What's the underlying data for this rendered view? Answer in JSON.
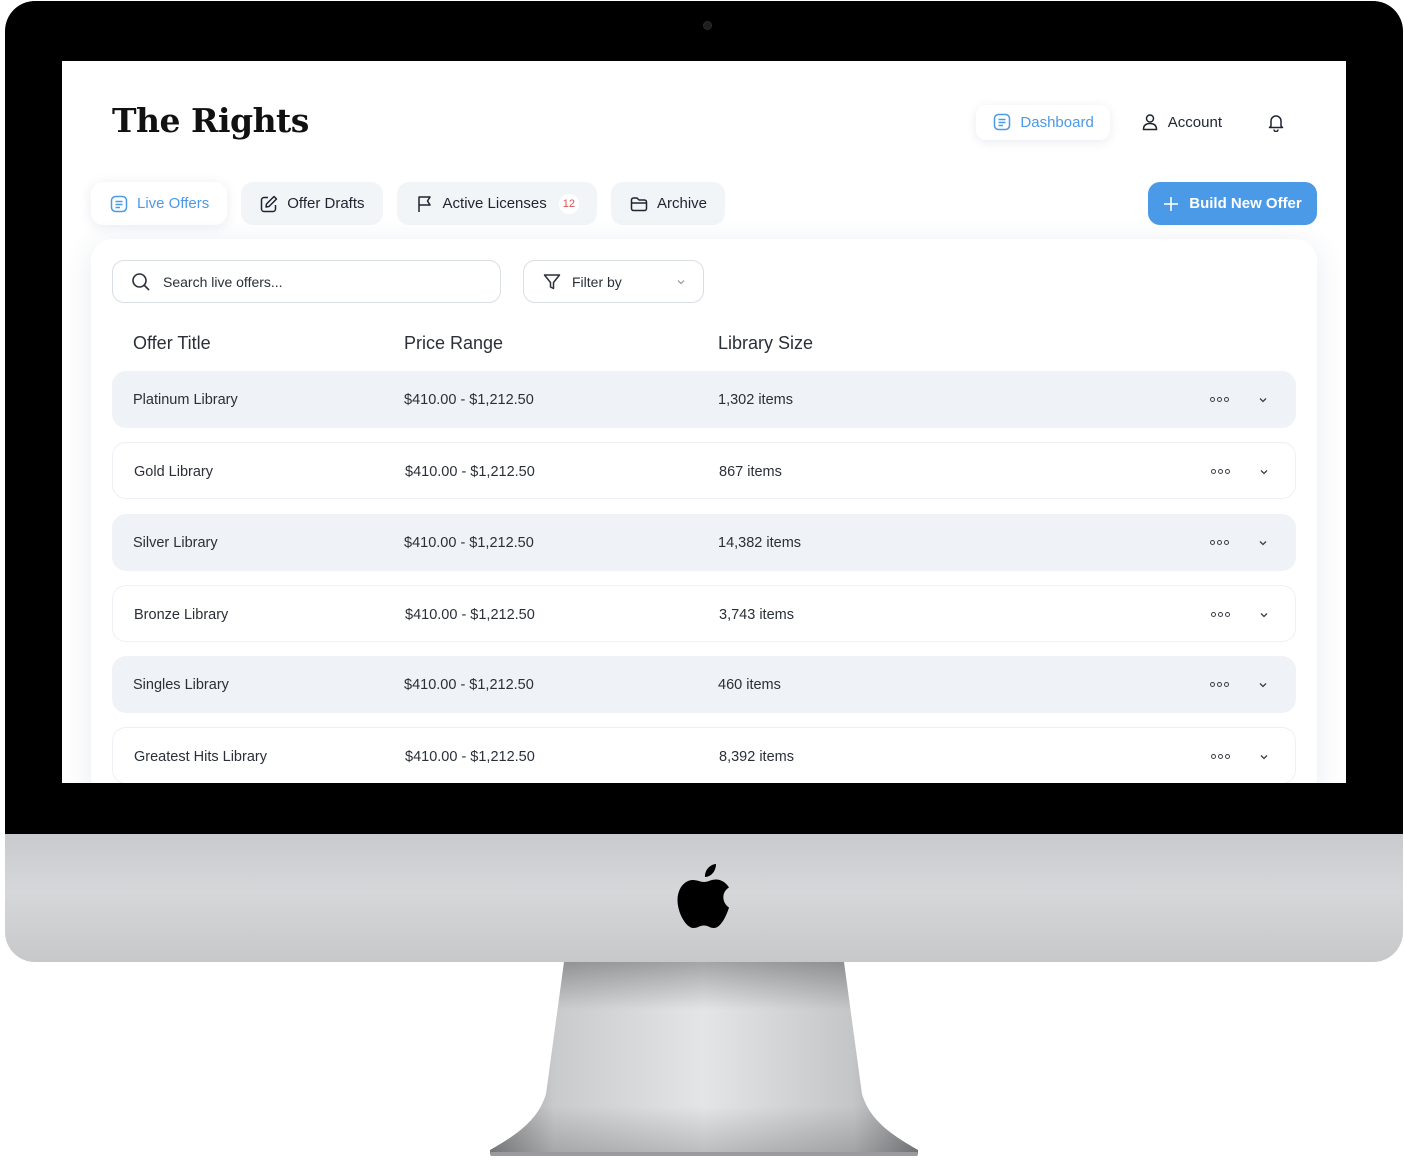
{
  "app": {
    "logo": "The Rights"
  },
  "topnav": {
    "dashboard_label": "Dashboard",
    "account_label": "Account"
  },
  "tabs": [
    {
      "label": "Live Offers",
      "icon": "document-icon",
      "active": true
    },
    {
      "label": "Offer Drafts",
      "icon": "edit-icon",
      "active": false
    },
    {
      "label": "Active Licenses",
      "icon": "flag-icon",
      "active": false,
      "badge": "12"
    },
    {
      "label": "Archive",
      "icon": "folder-icon",
      "active": false
    }
  ],
  "actions": {
    "build_label": "Build New Offer"
  },
  "search": {
    "placeholder": "Search live offers..."
  },
  "filter": {
    "label": "Filter by"
  },
  "table": {
    "columns": [
      "Offer Title",
      "Price Range",
      "Library Size"
    ],
    "rows": [
      {
        "title": "Platinum Library",
        "price": "$410.00 - $1,212.50",
        "size": "1,302 items"
      },
      {
        "title": "Gold Library",
        "price": "$410.00 - $1,212.50",
        "size": "867 items"
      },
      {
        "title": "Silver Library",
        "price": "$410.00 - $1,212.50",
        "size": "14,382 items"
      },
      {
        "title": "Bronze Library",
        "price": "$410.00 - $1,212.50",
        "size": "3,743 items"
      },
      {
        "title": "Singles Library",
        "price": "$410.00 - $1,212.50",
        "size": "460 items"
      },
      {
        "title": "Greatest Hits Library",
        "price": "$410.00 - $1,212.50",
        "size": "8,392 items"
      }
    ]
  },
  "colors": {
    "accent": "#4a9ae8",
    "badge": "#e2504c",
    "row_shaded": "#eff2f6"
  }
}
